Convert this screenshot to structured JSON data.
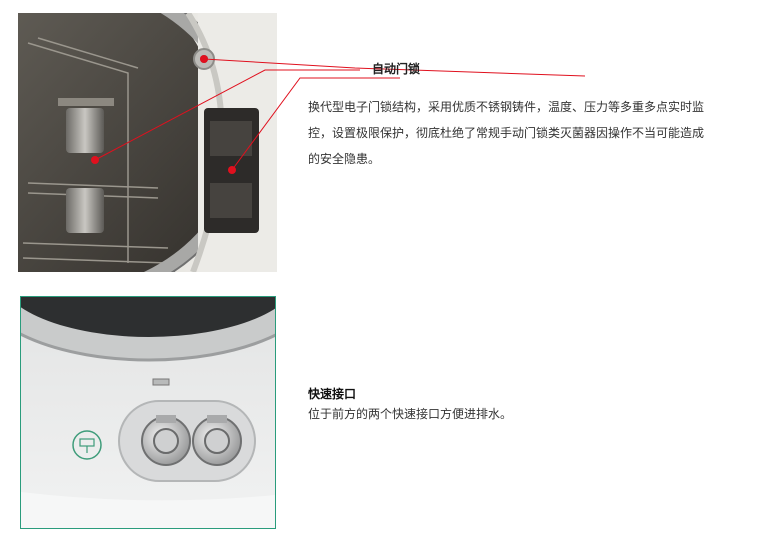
{
  "sections": [
    {
      "title": "自动门锁",
      "description": "换代型电子门锁结构，采用优质不锈钢铸件，温度、压力等多重多点实时监控，设置极限保护，彻底杜绝了常规手动门锁类灭菌器因操作不当可能造成的安全隐患。"
    },
    {
      "title": "快速接口",
      "description": "位于前方的两个快速接口方便进排水。"
    }
  ],
  "colors": {
    "leader_line": "#e0101e",
    "frame_accent": "#2a9c7c"
  }
}
